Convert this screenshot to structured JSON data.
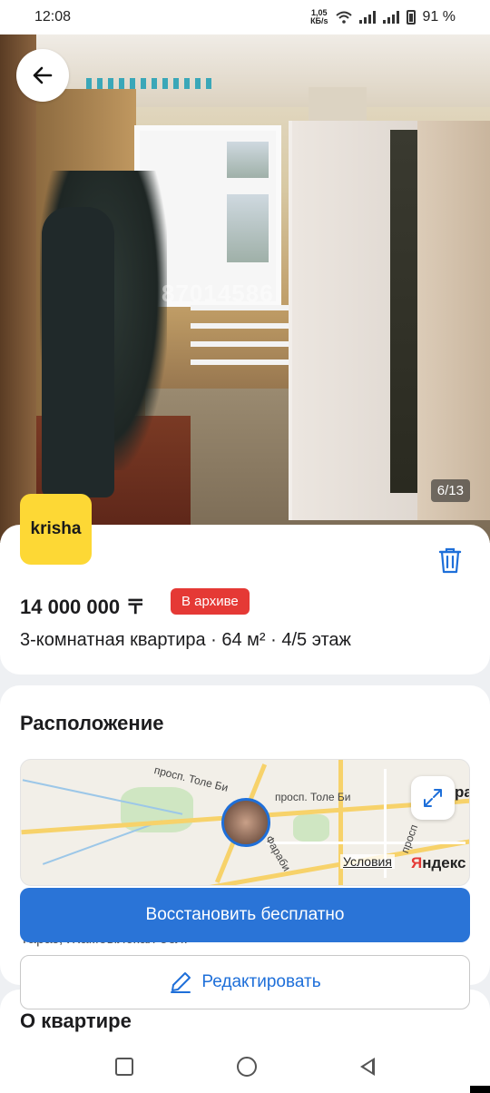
{
  "status_bar": {
    "time": "12:08",
    "speed_value": "1,05",
    "speed_unit": "КБ/s",
    "battery": "91 %"
  },
  "photo": {
    "counter": "6/13",
    "watermark": "87014586"
  },
  "listing": {
    "logo_text": "krisha",
    "price": "14 000 000 〒",
    "status_badge": "В архиве",
    "subtitle": "3-комнатная квартира · 64 м² · 4/5 этаж"
  },
  "location": {
    "title": "Расположение",
    "map": {
      "street_1": "просп. Толе Би",
      "street_2": "просп. Толе Би",
      "street_3": "Фараби",
      "street_4": "просп",
      "conditions_link": "Условия",
      "brand": "Яндекс",
      "edge_text": "ра"
    },
    "address": "Тараз, Жамбылская обл."
  },
  "actions": {
    "restore_label": "Восстановить бесплатно",
    "edit_label": "Редактировать"
  },
  "about": {
    "title": "О квартире"
  },
  "colors": {
    "accent": "#2a74d7",
    "badge_red": "#e53935",
    "logo_yellow": "#fdd835"
  }
}
